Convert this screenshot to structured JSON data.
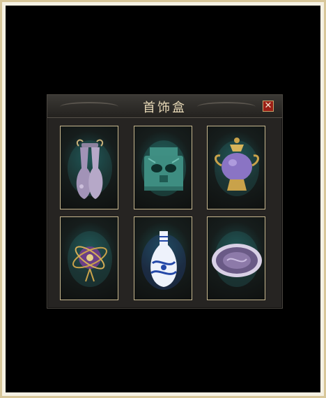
{
  "panel": {
    "title": "首饰盒",
    "close_glyph": "✕"
  },
  "slots": [
    {
      "icon": "double-vase-icon"
    },
    {
      "icon": "bronze-mask-icon"
    },
    {
      "icon": "lidded-urn-icon"
    },
    {
      "icon": "armillary-sphere-icon"
    },
    {
      "icon": "porcelain-vase-icon"
    },
    {
      "icon": "plate-icon"
    }
  ]
}
